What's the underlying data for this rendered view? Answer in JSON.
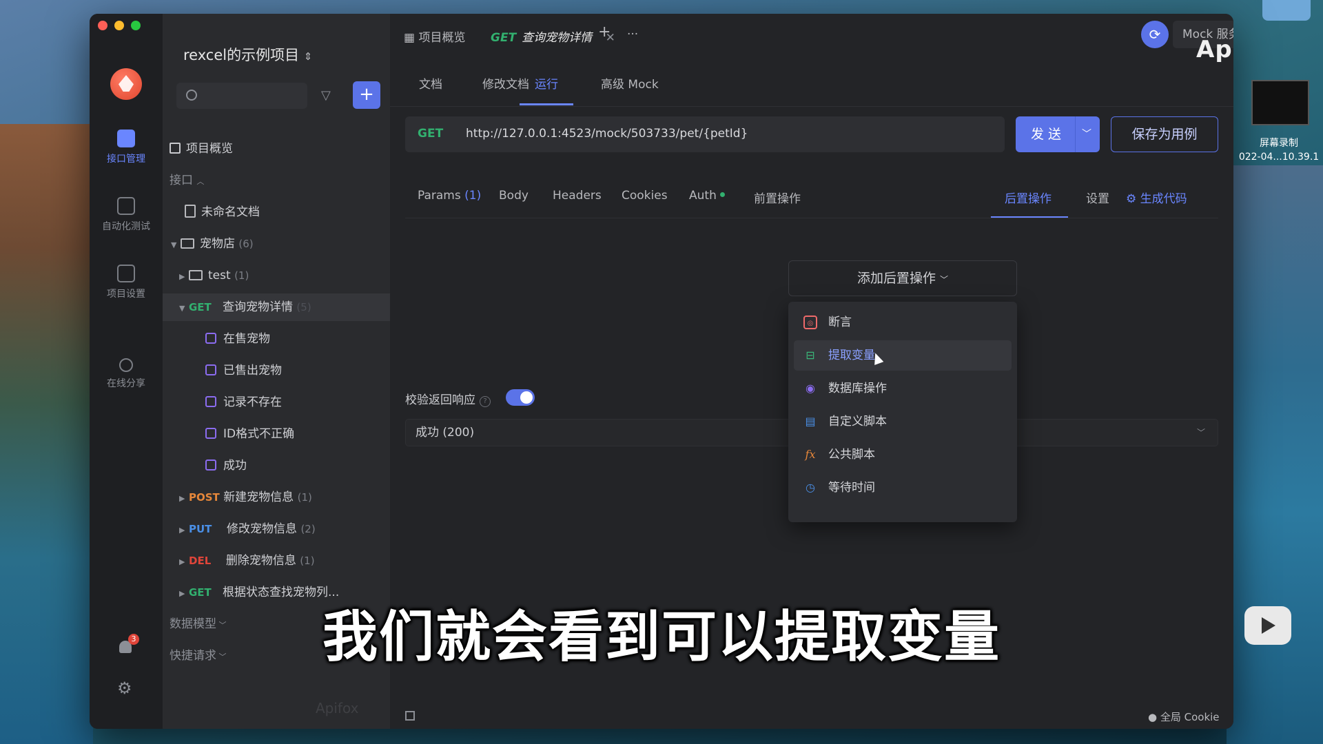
{
  "project": {
    "title": "rexcel的示例项目"
  },
  "rail": {
    "items": [
      {
        "label": "接口管理"
      },
      {
        "label": "自动化测试"
      },
      {
        "label": "项目设置"
      },
      {
        "label": "在线分享"
      }
    ],
    "notification_count": "3"
  },
  "tree": {
    "overview": "项目概览",
    "section_api": "接口",
    "unnamed_doc": "未命名文档",
    "rows": [
      {
        "name": "宠物店",
        "count": "(6)"
      },
      {
        "name": "test",
        "count": "(1)"
      },
      {
        "method": "GET",
        "name": "查询宠物详情",
        "count": "(5)"
      },
      {
        "name": "在售宠物"
      },
      {
        "name": "已售出宠物"
      },
      {
        "name": "记录不存在"
      },
      {
        "name": "ID格式不正确"
      },
      {
        "name": "成功"
      },
      {
        "method": "POST",
        "name": "新建宠物信息",
        "count": "(1)"
      },
      {
        "method": "PUT",
        "name": "修改宠物信息",
        "count": "(2)"
      },
      {
        "method": "DEL",
        "name": "删除宠物信息",
        "count": "(1)"
      },
      {
        "method": "GET",
        "name": "根据状态查找宠物列..."
      }
    ],
    "section_models": "数据模型",
    "section_quick": "快捷请求",
    "watermark": "Apifox"
  },
  "tabs": {
    "overview": "项目概览",
    "active_method": "GET",
    "active_name": "查询宠物详情",
    "mock_service": "Mock 服务",
    "brand": "Apifox"
  },
  "subtabs": [
    "文档",
    "修改文档",
    "运行",
    "高级 Mock"
  ],
  "request": {
    "method": "GET",
    "url": "http://127.0.0.1:4523/mock/503733/pet/{petId}",
    "send": "发送",
    "save_case": "保存为用例"
  },
  "param_tabs": {
    "params": "Params",
    "params_count": "(1)",
    "body": "Body",
    "headers": "Headers",
    "cookies": "Cookies",
    "auth": "Auth",
    "pre": "前置操作",
    "post": "后置操作",
    "settings": "设置",
    "gen_code": "生成代码"
  },
  "post_ops": {
    "add_label": "添加后置操作",
    "menu": [
      "断言",
      "提取变量",
      "数据库操作",
      "自定义脚本",
      "公共脚本",
      "等待时间"
    ]
  },
  "validation": {
    "label": "校验返回响应",
    "response": "成功 (200)"
  },
  "statusbar": {
    "global_cookie": "全局 Cookie"
  },
  "overlay": {
    "subtitle": "我们就会看到可以提取变量",
    "screen_record_title": "屏幕录制",
    "screen_record_date": "022-04...10.39.1"
  }
}
